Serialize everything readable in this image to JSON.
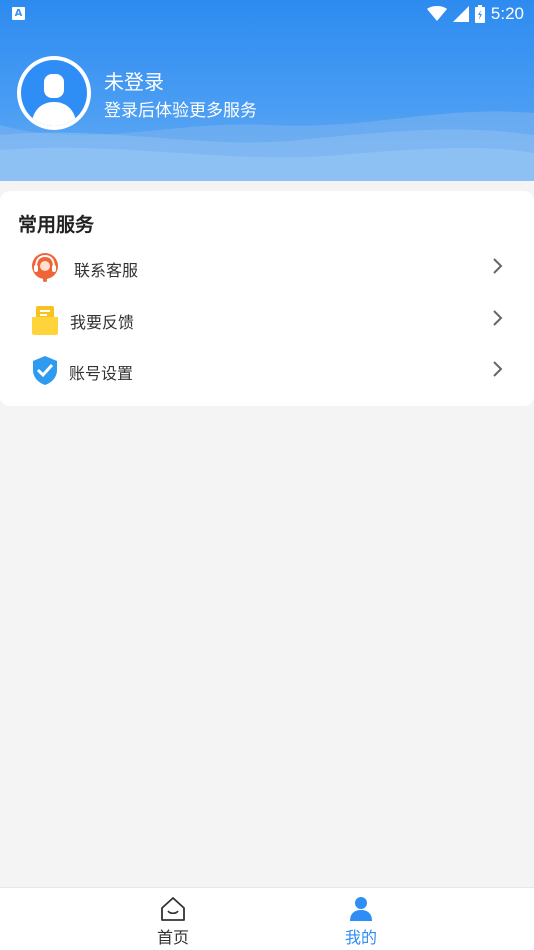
{
  "status_bar": {
    "indicator": "A",
    "time": "5:20"
  },
  "profile": {
    "name": "未登录",
    "subtitle": "登录后体验更多服务"
  },
  "services": {
    "title": "常用服务",
    "items": [
      {
        "label": "联系客服",
        "icon": "headset-icon"
      },
      {
        "label": "我要反馈",
        "icon": "feedback-folder-icon"
      },
      {
        "label": "账号设置",
        "icon": "shield-check-icon"
      }
    ]
  },
  "nav": {
    "tabs": [
      {
        "label": "首页",
        "icon": "home-icon",
        "active": false
      },
      {
        "label": "我的",
        "icon": "user-icon",
        "active": true
      }
    ]
  },
  "colors": {
    "primary": "#2f8ef5",
    "header_gradient_top": "#2d8bf0",
    "header_gradient_bottom": "#6aaef2",
    "background": "#f4f4f4",
    "nav_active": "#2f8ef5",
    "nav_inactive": "#333333"
  }
}
